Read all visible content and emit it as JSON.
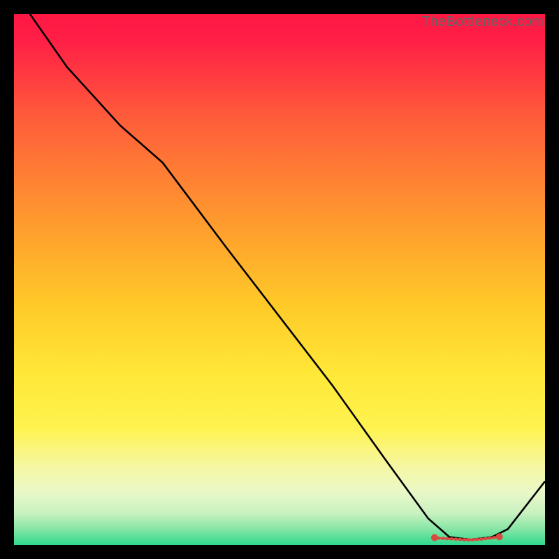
{
  "watermark": "TheBottleneck.com",
  "chart_data": {
    "type": "line",
    "title": "",
    "xlabel": "",
    "ylabel": "",
    "xlim": [
      0,
      100
    ],
    "ylim": [
      0,
      100
    ],
    "series": [
      {
        "name": "curve",
        "x": [
          3,
          10,
          20,
          28,
          40,
          50,
          60,
          70,
          78,
          82,
          86,
          90,
          93,
          100
        ],
        "y": [
          100,
          90,
          79,
          72,
          56,
          43,
          30,
          16,
          5,
          1.5,
          1,
          1.5,
          3,
          12
        ]
      },
      {
        "name": "dots",
        "x": [
          79.2,
          80.0,
          80.8,
          81.6,
          82.4,
          83.2,
          84.0,
          84.8,
          85.6,
          86.4,
          87.2,
          88.0,
          88.8,
          89.6,
          90.4,
          91.4
        ],
        "y": [
          1.4,
          1.3,
          1.25,
          1.2,
          1.15,
          1.1,
          1.05,
          1.0,
          1.0,
          1.0,
          1.05,
          1.1,
          1.2,
          1.3,
          1.4,
          1.55
        ]
      }
    ],
    "gradient_stops": [
      {
        "offset": 0.0,
        "color": "#ff1744"
      },
      {
        "offset": 0.05,
        "color": "#ff1f46"
      },
      {
        "offset": 0.2,
        "color": "#ff5e3a"
      },
      {
        "offset": 0.4,
        "color": "#ff9d2e"
      },
      {
        "offset": 0.55,
        "color": "#ffca28"
      },
      {
        "offset": 0.68,
        "color": "#ffe838"
      },
      {
        "offset": 0.78,
        "color": "#fff350"
      },
      {
        "offset": 0.85,
        "color": "#f6f7a0"
      },
      {
        "offset": 0.9,
        "color": "#eaf8c8"
      },
      {
        "offset": 0.94,
        "color": "#c8f2c0"
      },
      {
        "offset": 0.97,
        "color": "#86e5a5"
      },
      {
        "offset": 1.0,
        "color": "#2fd98e"
      }
    ],
    "dot_color": "#d84a3f",
    "curve_color": "#000000"
  }
}
